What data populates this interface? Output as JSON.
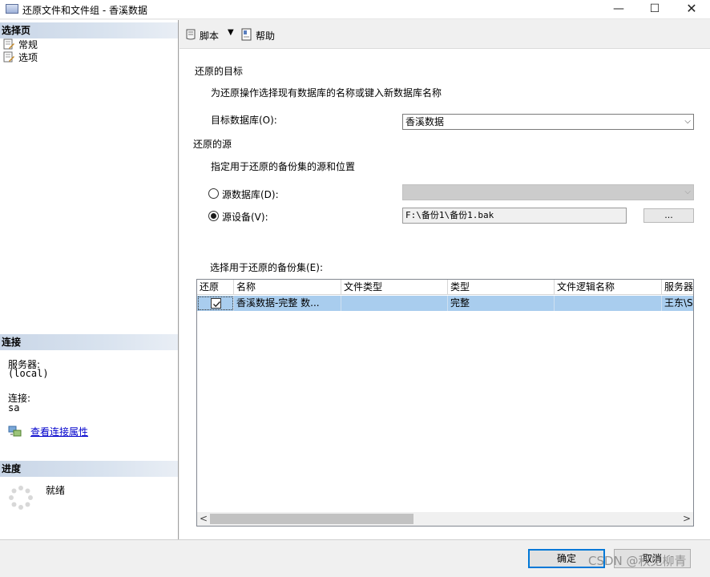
{
  "window": {
    "title": "还原文件和文件组 - 香溪数据",
    "minimize_glyph": "—",
    "maximize_glyph": "☐",
    "close_glyph": "✕"
  },
  "left": {
    "select_page_header": "选择页",
    "pages": [
      {
        "label": "常规",
        "icon": "page-wrench-icon"
      },
      {
        "label": "选项",
        "icon": "page-wrench-icon"
      }
    ],
    "connection_header": "连接",
    "server_label": "服务器:",
    "server_value": "(local)",
    "connection_label": "连接:",
    "connection_value": "sa",
    "view_connection_link": "查看连接属性",
    "progress_header": "进度",
    "progress_status": "就绪"
  },
  "toolbar": {
    "script_label": "脚本",
    "help_label": "帮助"
  },
  "destination": {
    "section_title": "还原的目标",
    "description": "为还原操作选择现有数据库的名称或键入新数据库名称",
    "target_db_label": "目标数据库(O):",
    "target_db_value": "香溪数据"
  },
  "source": {
    "section_title": "还原的源",
    "description": "指定用于还原的备份集的源和位置",
    "from_database_label": "源数据库(D):",
    "from_database_value": "",
    "from_device_label": "源设备(V):",
    "from_device_value": "F:\\备份1\\备份1.bak",
    "browse_button": "...",
    "selected_option": "device"
  },
  "backup_sets": {
    "label": "选择用于还原的备份集(E):",
    "columns": [
      "还原",
      "名称",
      "文件类型",
      "类型",
      "文件逻辑名称",
      "服务器"
    ],
    "rows": [
      {
        "restore": true,
        "name": "香溪数据-完整 数...",
        "file_type": "",
        "type": "完整",
        "logical_name": "",
        "server": "王东\\S"
      }
    ],
    "scroll_left": "<",
    "scroll_right": ">"
  },
  "buttons": {
    "ok": "确定",
    "cancel": "取消"
  },
  "watermark": "CSDN @秋见柳青",
  "colors": {
    "selected_row": "#a9cdee",
    "default_button_border": "#0078d7",
    "link": "#0000cc"
  }
}
